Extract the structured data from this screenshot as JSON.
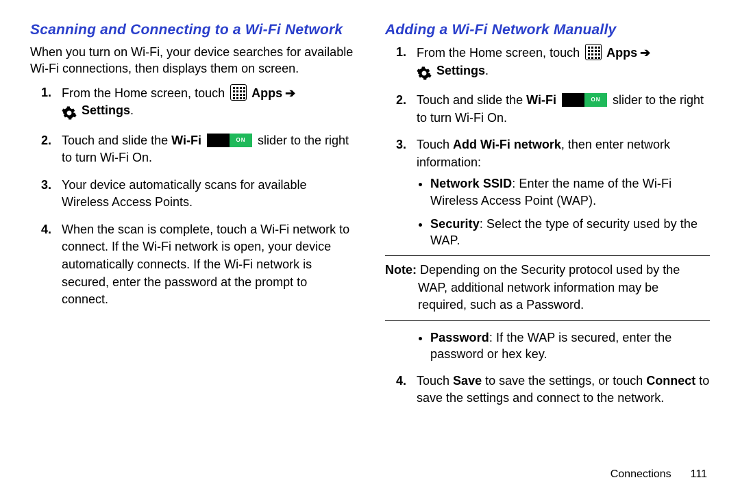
{
  "left": {
    "heading": "Scanning and Connecting to a Wi-Fi Network",
    "intro": "When you turn on Wi-Fi, your device searches for available Wi-Fi connections, then displays them on screen.",
    "s1_a": "From the Home screen, touch",
    "s1_apps": "Apps",
    "s1_settings": "Settings",
    "s1_dot": ".",
    "s2_a": "Touch and slide the ",
    "s2_wifi": "Wi-Fi",
    "s2_b": " slider to the right to turn Wi-Fi On.",
    "s3": "Your device automatically scans for available Wireless Access Points.",
    "s4": "When the scan is complete, touch a Wi-Fi network to connect. If the Wi-Fi network is open, your device automatically connects. If the Wi-Fi network is secured, enter the password at the prompt to connect."
  },
  "right": {
    "heading": "Adding a Wi-Fi Network Manually",
    "s1_a": "From the Home screen, touch",
    "s1_apps": "Apps",
    "s1_settings": "Settings",
    "s1_dot": ".",
    "s2_a": "Touch and slide the ",
    "s2_wifi": "Wi-Fi",
    "s2_b": " slider to the right to turn Wi-Fi On.",
    "s3_a": "Touch ",
    "s3_bold": "Add Wi-Fi network",
    "s3_b": ", then enter network information:",
    "b1_label": "Network SSID",
    "b1_text": ": Enter the name of the Wi-Fi Wireless Access Point (WAP).",
    "b2_label": "Security",
    "b2_text": ": Select the type of security used by the WAP.",
    "note_label": "Note:",
    "note_text": " Depending on the Security protocol used by the WAP, additional network information may be required, such as a Password.",
    "b3_label": "Password",
    "b3_text": ": If the WAP is secured, enter the password or hex key.",
    "s4_a": "Touch ",
    "s4_save": "Save",
    "s4_b": " to save the settings, or touch ",
    "s4_connect": "Connect",
    "s4_c": " to save the settings and connect to the network."
  },
  "footer": {
    "section": "Connections",
    "page": "111"
  },
  "icons": {
    "slider_on": "ON"
  }
}
